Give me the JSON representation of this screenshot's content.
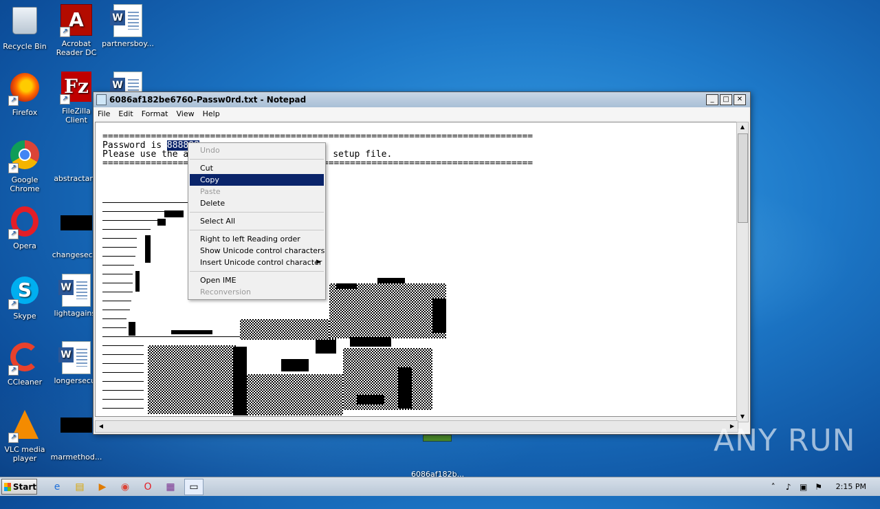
{
  "desktop": {
    "icons": [
      {
        "label": "Recycle Bin",
        "icon": "recycle-bin-icon"
      },
      {
        "label": "Acrobat Reader DC",
        "icon": "acrobat-icon"
      },
      {
        "label": "partnersboy...",
        "icon": "word-doc-icon"
      },
      {
        "label": "Firefox",
        "icon": "firefox-icon"
      },
      {
        "label": "FileZilla Client",
        "icon": "filezilla-icon"
      },
      {
        "label": "Google Chrome",
        "icon": "chrome-icon"
      },
      {
        "label": "abstractany",
        "icon": "file-icon"
      },
      {
        "label": "Opera",
        "icon": "opera-icon"
      },
      {
        "label": "changesecur",
        "icon": "file-icon"
      },
      {
        "label": "Skype",
        "icon": "skype-icon"
      },
      {
        "label": "lightagainst",
        "icon": "word-doc-icon"
      },
      {
        "label": "CCleaner",
        "icon": "ccleaner-icon"
      },
      {
        "label": "longersecur",
        "icon": "word-doc-icon"
      },
      {
        "label": "VLC media player",
        "icon": "vlc-icon"
      },
      {
        "label": "marmethod...",
        "icon": "file-icon"
      },
      {
        "label": "6086af182b...",
        "icon": "file-icon"
      }
    ]
  },
  "notepad": {
    "title": "6086af182be6760-Passw0rd.txt - Notepad",
    "menu": [
      "File",
      "Edit",
      "Format",
      "View",
      "Help"
    ],
    "lines": {
      "rule": "================================================================================",
      "password_prefix": "Password is ",
      "password_selected": "888888",
      "please_start": "Please use the a",
      "please_end": "setup file."
    }
  },
  "context_menu": {
    "undo": "Undo",
    "cut": "Cut",
    "copy": "Copy",
    "paste": "Paste",
    "delete": "Delete",
    "select_all": "Select All",
    "rtl": "Right to left Reading order",
    "show_unicode": "Show Unicode control characters",
    "insert_unicode": "Insert Unicode control character",
    "open_ime": "Open IME",
    "reconversion": "Reconversion"
  },
  "taskbar": {
    "start": "Start",
    "clock": "2:15 PM"
  },
  "watermark": "ANY RUN",
  "colors": {
    "selection": "#0a246a",
    "desktop": "#1d78c8"
  }
}
